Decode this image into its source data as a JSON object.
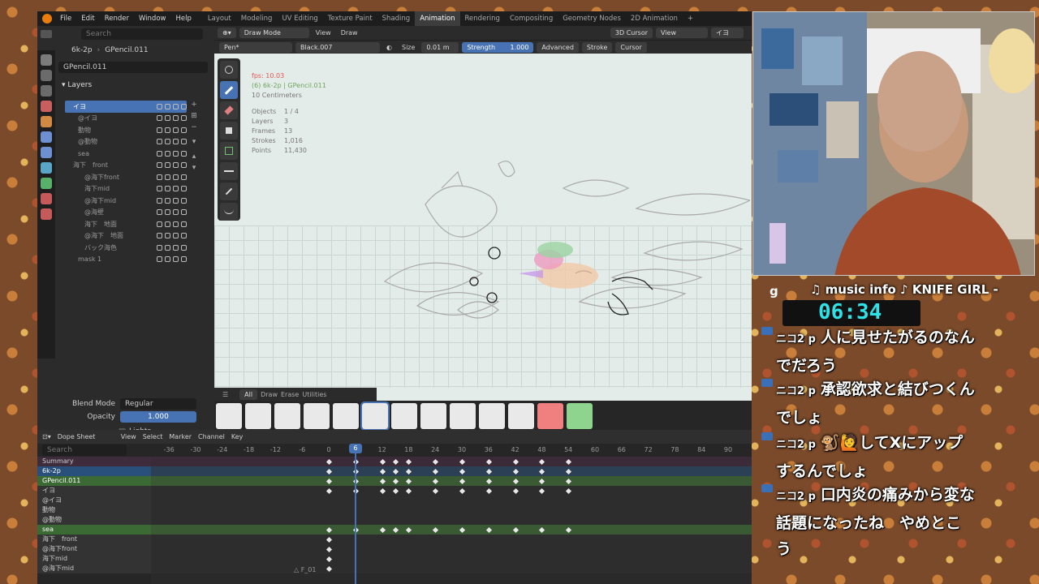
{
  "topbar": {
    "menus": [
      "File",
      "Edit",
      "Render",
      "Window",
      "Help"
    ],
    "workspaces": [
      "Layout",
      "Modeling",
      "UV Editing",
      "Texture Paint",
      "Shading",
      "Animation",
      "Rendering",
      "Compositing",
      "Geometry Nodes",
      "2D Animation",
      "+"
    ],
    "active_workspace": "Animation"
  },
  "props": {
    "search_placeholder": "Search",
    "breadcrumb_a": "6k-2p",
    "breadcrumb_b": "GPencil.011",
    "object_name": "GPencil.011",
    "layers_title": "Layers",
    "layers": [
      {
        "name": "イヨ",
        "active": true
      },
      {
        "name": "@イヨ"
      },
      {
        "name": "動物"
      },
      {
        "name": "@動物"
      },
      {
        "name": "sea"
      },
      {
        "name": "海下　front"
      },
      {
        "name": "@海下front"
      },
      {
        "name": "海下mid"
      },
      {
        "name": "@海下mid"
      },
      {
        "name": "@海壁"
      },
      {
        "name": "海下　地面"
      },
      {
        "name": "@海下　地面"
      },
      {
        "name": "バック海色"
      },
      {
        "name": "mask 1"
      }
    ],
    "blend_mode_label": "Blend Mode",
    "blend_mode_value": "Regular",
    "opacity_label": "Opacity",
    "opacity_value": "1.000",
    "lights_label": "Lights"
  },
  "viewport": {
    "mode": "Draw Mode",
    "menu_view": "View",
    "menu_draw": "Draw",
    "cursor_btn": "3D Cursor",
    "view_btn": "View",
    "layer_btn": "イヨ",
    "brush": "Pen*",
    "material": "Black.007",
    "size_label": "Size",
    "size_value": "0.01 m",
    "strength_label": "Strength",
    "strength_value": "1.000",
    "advanced": "Advanced",
    "stroke": "Stroke",
    "cursor": "Cursor",
    "stats": {
      "fps": "fps: 10.03",
      "object_line": "(6) 6k-2p | GPencil.011",
      "scale": "10 Centimeters",
      "objects_label": "Objects",
      "objects": "1 / 4",
      "layers_label": "Layers",
      "layers": "3",
      "frames_label": "Frames",
      "frames": "13",
      "strokes_label": "Strokes",
      "strokes": "1,016",
      "points_label": "Points",
      "points": "11,430"
    },
    "brush_tabs": [
      "All",
      "Draw",
      "Erase",
      "Utilities"
    ]
  },
  "dope": {
    "editor": "Dope Sheet",
    "menus": [
      "View",
      "Select",
      "Marker",
      "Channel",
      "Key"
    ],
    "search_placeholder": "Search",
    "ruler": [
      "-36",
      "-30",
      "-24",
      "-18",
      "-12",
      "-6",
      "0",
      "6",
      "12",
      "18",
      "24",
      "30",
      "36",
      "42",
      "48",
      "54",
      "60",
      "66",
      "72",
      "78",
      "84",
      "90"
    ],
    "current_frame": "6",
    "marker": "F_01",
    "channels": [
      {
        "label": "Summary",
        "kind": "summary"
      },
      {
        "label": "6k-2p",
        "kind": "obj"
      },
      {
        "label": "GPencil.011",
        "kind": "gp"
      },
      {
        "label": "イヨ",
        "kind": "layer"
      },
      {
        "label": "@イヨ",
        "kind": "layer"
      },
      {
        "label": "動物",
        "kind": "layer"
      },
      {
        "label": "@動物",
        "kind": "layer"
      },
      {
        "label": "sea",
        "kind": "gp"
      },
      {
        "label": "海下　front",
        "kind": "layer"
      },
      {
        "label": "@海下front",
        "kind": "layer"
      },
      {
        "label": "海下mid",
        "kind": "layer"
      },
      {
        "label": "@海下mid",
        "kind": "layer"
      }
    ]
  },
  "overlay": {
    "music": "♫ music info ♪  KNIFE GIRL -",
    "clock": "06:34",
    "comments": [
      {
        "who": "ニコ2 p",
        "text": "人に見せたがるのなん",
        "cont": "でだろう"
      },
      {
        "who": "ニコ2 p",
        "text": "承認欲求と結びつくん",
        "cont": "でしょ"
      },
      {
        "who": "ニコ2 p",
        "text": "🐒🙋してXにアップ",
        "cont": "するんでしょ"
      },
      {
        "who": "ニコ2 p",
        "text": "口内炎の痛みから変な",
        "cont": "話題になったね　やめとこ",
        "cont2": "う"
      }
    ]
  },
  "colors": {
    "accent": "#4772b3",
    "clock": "#2ee3e8"
  }
}
